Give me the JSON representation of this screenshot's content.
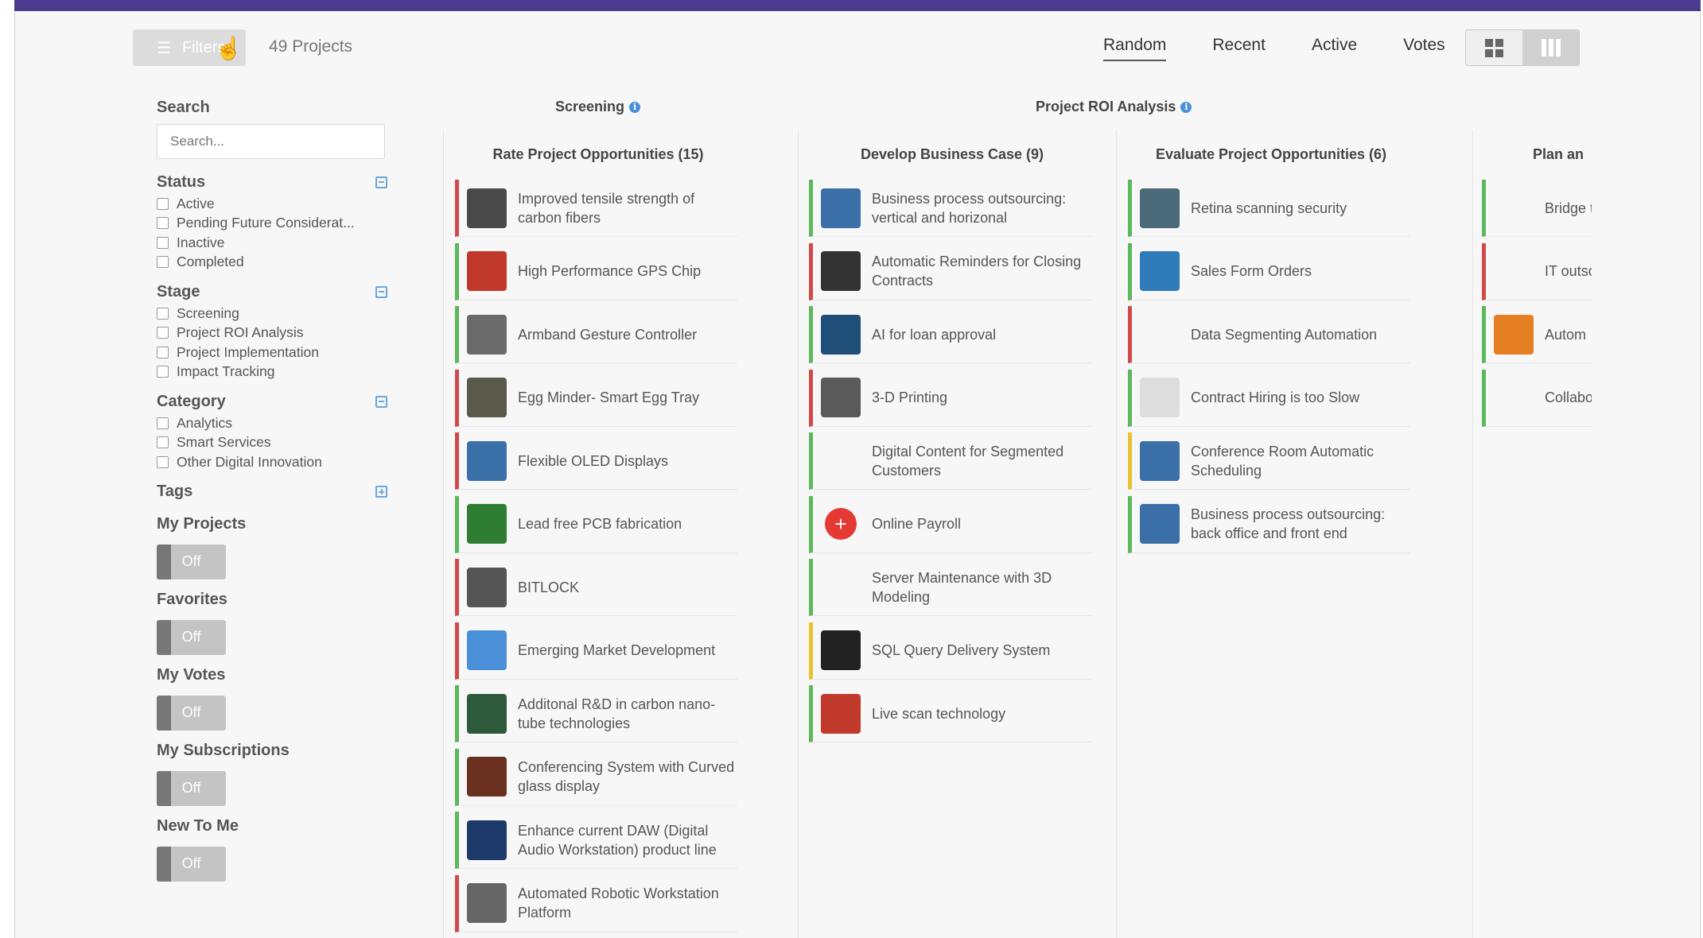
{
  "toolbar": {
    "filters_label": "Filters",
    "project_count": "49 Projects",
    "sort_tabs": [
      "Random",
      "Recent",
      "Active",
      "Votes"
    ]
  },
  "sidebar": {
    "search_title": "Search",
    "search_placeholder": "Search...",
    "status_title": "Status",
    "status_items": [
      "Active",
      "Pending Future Considerat...",
      "Inactive",
      "Completed"
    ],
    "stage_title": "Stage",
    "stage_items": [
      "Screening",
      "Project ROI Analysis",
      "Project Implementation",
      "Impact Tracking"
    ],
    "category_title": "Category",
    "category_items": [
      "Analytics",
      "Smart Services",
      "Other Digital Innovation"
    ],
    "tags_title": "Tags",
    "toggles": [
      {
        "label": "My Projects",
        "state": "Off"
      },
      {
        "label": "Favorites",
        "state": "Off"
      },
      {
        "label": "My Votes",
        "state": "Off"
      },
      {
        "label": "My Subscriptions",
        "state": "Off"
      },
      {
        "label": "New To Me",
        "state": "Off"
      }
    ]
  },
  "stages": {
    "screening": "Screening",
    "roi": "Project ROI Analysis"
  },
  "columns": [
    {
      "title": "Rate Project Opportunities (15)",
      "cards": [
        {
          "title": "Improved tensile strength of carbon fibers",
          "status": "red",
          "thumb": "#4a4a4a"
        },
        {
          "title": "High Performance GPS Chip",
          "status": "green",
          "thumb": "#c0392b"
        },
        {
          "title": "Armband Gesture Controller",
          "status": "green",
          "thumb": "#6b6b6b"
        },
        {
          "title": "Egg Minder- Smart Egg Tray",
          "status": "red",
          "thumb": "#5a5a4a"
        },
        {
          "title": "Flexible OLED Displays",
          "status": "red",
          "thumb": "#3b6fa8"
        },
        {
          "title": "Lead free PCB fabrication",
          "status": "green",
          "thumb": "#2e7d32"
        },
        {
          "title": "BITLOCK",
          "status": "red",
          "thumb": "#555555"
        },
        {
          "title": "Emerging Market Development",
          "status": "red",
          "thumb": "#4a90d9"
        },
        {
          "title": "Additonal R&D in carbon nano-tube technologies",
          "status": "green",
          "thumb": "#2c5a3a"
        },
        {
          "title": "Conferencing System with Curved glass display",
          "status": "green",
          "thumb": "#6a3020"
        },
        {
          "title": "Enhance current DAW (Digital Audio Workstation) product line",
          "status": "green",
          "thumb": "#1e3a6a"
        },
        {
          "title": "Automated Robotic Workstation Platform",
          "status": "red",
          "thumb": "#666666"
        }
      ]
    },
    {
      "title": "Develop Business Case (9)",
      "cards": [
        {
          "title": "Business process outsourcing: vertical and horizonal",
          "status": "green",
          "thumb": "#3b6fa8"
        },
        {
          "title": "Automatic Reminders for Closing Contracts",
          "status": "red",
          "thumb": "#333333"
        },
        {
          "title": "AI for loan approval",
          "status": "green",
          "thumb": "#1f4e79"
        },
        {
          "title": "3-D Printing",
          "status": "red",
          "thumb": "#5a5a5a"
        },
        {
          "title": "Digital Content for Segmented Customers",
          "status": "green",
          "thumb": "#f7f7f7"
        },
        {
          "title": "Online Payroll",
          "status": "green",
          "thumb": "#e53935"
        },
        {
          "title": "Server Maintenance with 3D Modeling",
          "status": "green",
          "thumb": "#f7f7f7"
        },
        {
          "title": "SQL Query Delivery System",
          "status": "yellow",
          "thumb": "#222222"
        },
        {
          "title": "Live scan technology",
          "status": "green",
          "thumb": "#c0392b"
        }
      ]
    },
    {
      "title": "Evaluate Project Opportunities (6)",
      "cards": [
        {
          "title": "Retina scanning security",
          "status": "green",
          "thumb": "#4a6a7a"
        },
        {
          "title": "Sales Form Orders",
          "status": "green",
          "thumb": "#2f7ab8"
        },
        {
          "title": "Data Segmenting Automation",
          "status": "red",
          "thumb": "#f7f7f7"
        },
        {
          "title": "Contract Hiring is too Slow",
          "status": "green",
          "thumb": "#dddddd"
        },
        {
          "title": "Conference Room Automatic Scheduling",
          "status": "yellow",
          "thumb": "#3b6fa8"
        },
        {
          "title": "Business process outsourcing: back office and front end",
          "status": "green",
          "thumb": "#3b6fa8"
        }
      ]
    },
    {
      "title": "Plan an",
      "cards": [
        {
          "title": "Bridge the and conne",
          "status": "green",
          "thumb": "#f7f7f7"
        },
        {
          "title": "IT outsou for winn",
          "status": "red",
          "thumb": "#f7f7f7"
        },
        {
          "title": "Autom",
          "status": "green",
          "thumb": "#e67e22"
        },
        {
          "title": "Collabora transforn",
          "status": "green",
          "thumb": "#f7f7f7"
        }
      ]
    }
  ]
}
